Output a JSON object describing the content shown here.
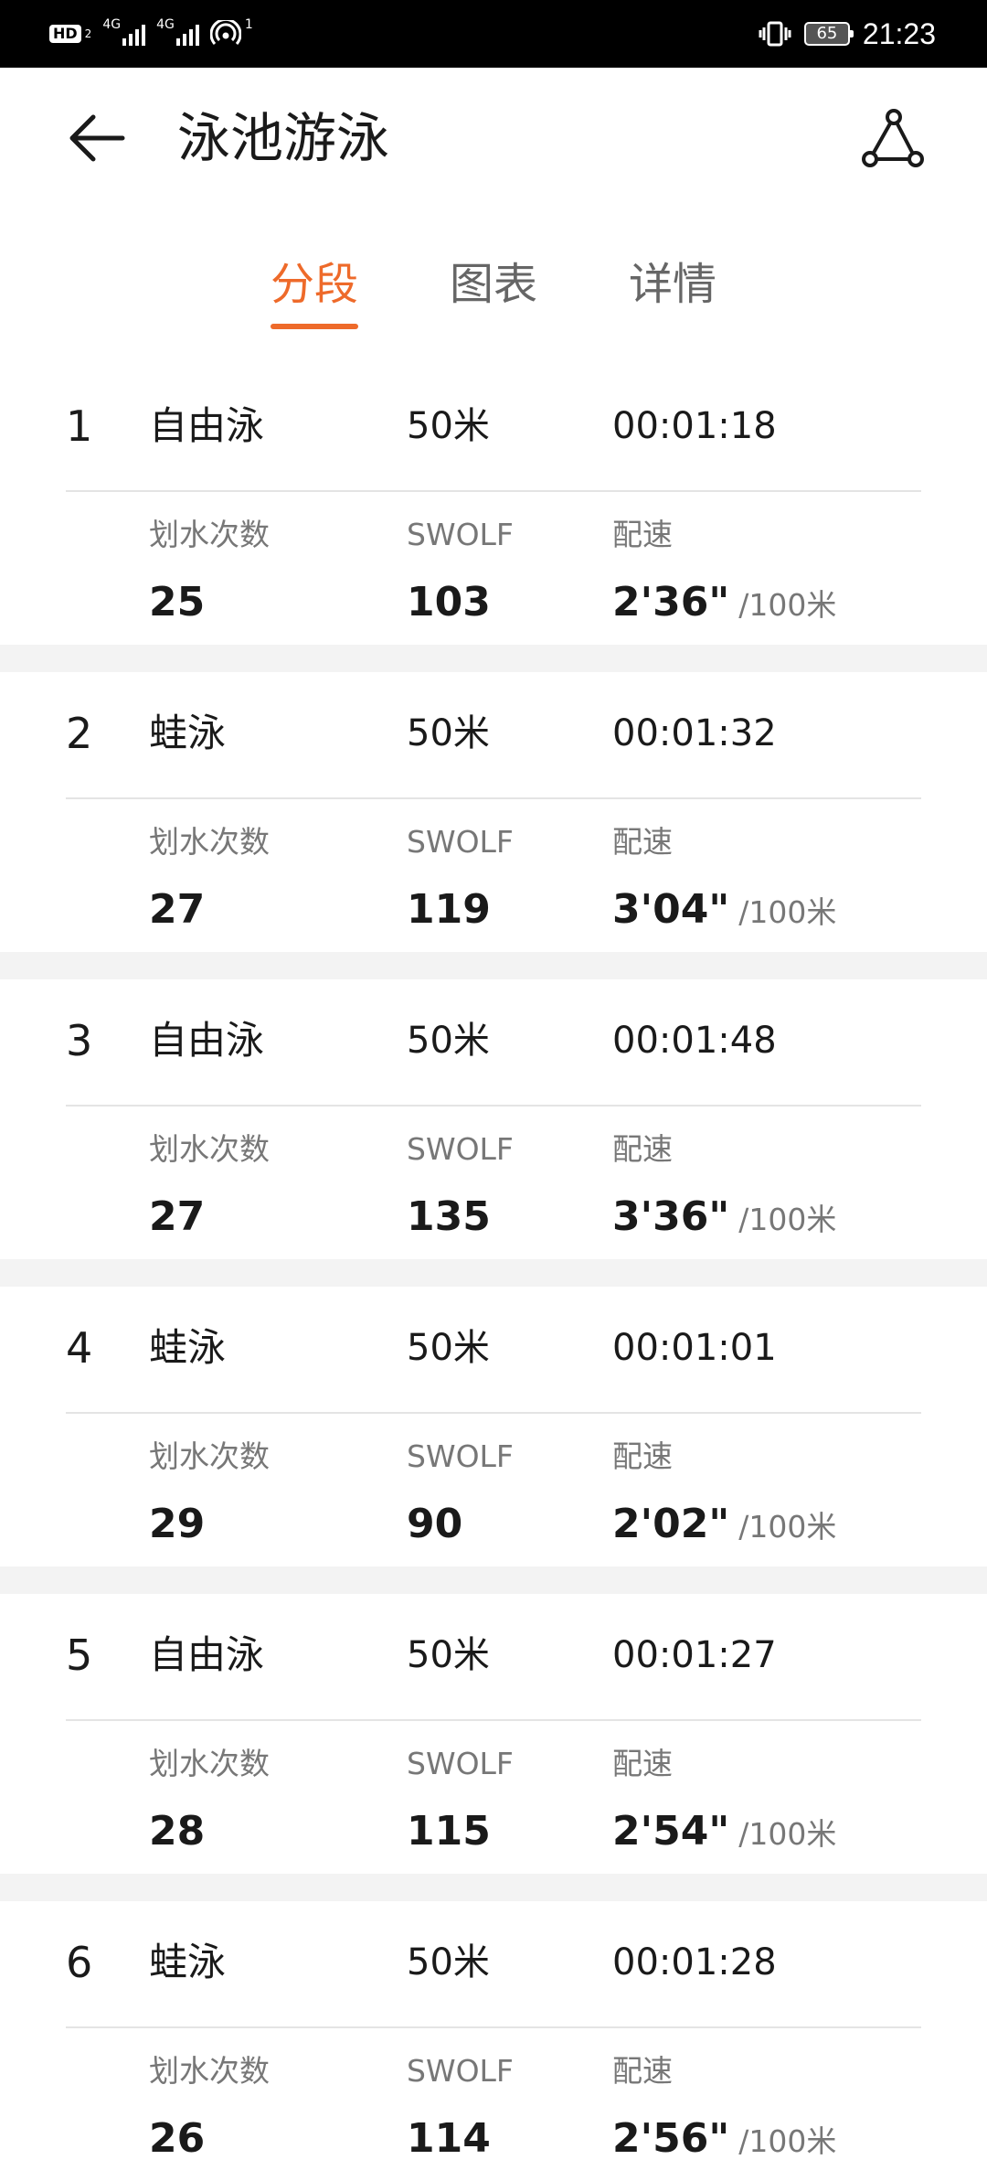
{
  "status_bar": {
    "hd": "HD",
    "hd_sub": "2",
    "net1": "4G",
    "net2": "4G",
    "hotspot_count": "1",
    "battery": "65",
    "time": "21:23"
  },
  "app_bar": {
    "title": "泳池游泳"
  },
  "tabs": [
    {
      "label": "分段",
      "active": true
    },
    {
      "label": "图表",
      "active": false
    },
    {
      "label": "详情",
      "active": false
    }
  ],
  "labels": {
    "strokes": "划水次数",
    "swolf": "SWOLF",
    "pace": "配速",
    "pace_unit": "/100米"
  },
  "colors": {
    "accent": "#ee6a2a",
    "text": "#1a1a1a",
    "secondary": "#777777",
    "separator": "#f3f3f3"
  },
  "segments": [
    {
      "index": "1",
      "stroke": "自由泳",
      "distance": "50米",
      "time": "00:01:18",
      "strokes": "25",
      "swolf": "103",
      "pace": "2'36\""
    },
    {
      "index": "2",
      "stroke": "蛙泳",
      "distance": "50米",
      "time": "00:01:32",
      "strokes": "27",
      "swolf": "119",
      "pace": "3'04\""
    },
    {
      "index": "3",
      "stroke": "自由泳",
      "distance": "50米",
      "time": "00:01:48",
      "strokes": "27",
      "swolf": "135",
      "pace": "3'36\""
    },
    {
      "index": "4",
      "stroke": "蛙泳",
      "distance": "50米",
      "time": "00:01:01",
      "strokes": "29",
      "swolf": "90",
      "pace": "2'02\""
    },
    {
      "index": "5",
      "stroke": "自由泳",
      "distance": "50米",
      "time": "00:01:27",
      "strokes": "28",
      "swolf": "115",
      "pace": "2'54\""
    },
    {
      "index": "6",
      "stroke": "蛙泳",
      "distance": "50米",
      "time": "00:01:28",
      "strokes": "26",
      "swolf": "114",
      "pace": "2'56\""
    }
  ]
}
